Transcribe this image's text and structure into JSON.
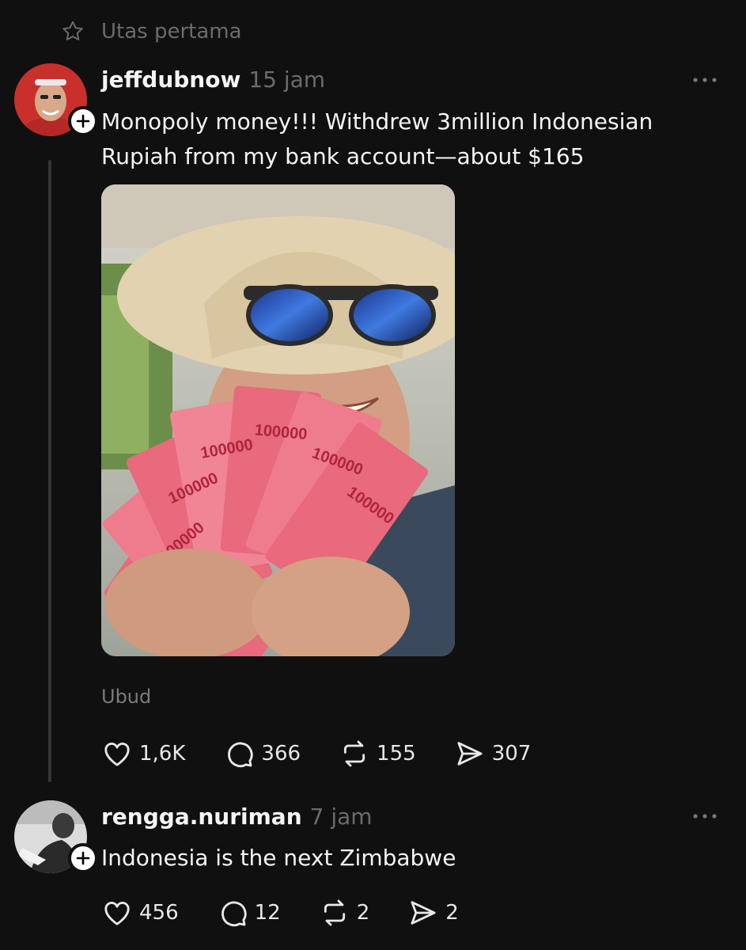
{
  "pinned": {
    "icon": "star-icon",
    "label": "Utas pertama"
  },
  "post": {
    "username": "jeffdubnow",
    "time": "15 jam",
    "text": "Monopoly money!!! Withdrew 3million Indonesian Rupiah from my bank account—about $165",
    "location": "Ubud",
    "image_banknote_values": [
      "100000",
      "100000",
      "100000",
      "100000",
      "100000",
      "100000",
      "100000"
    ],
    "stats": {
      "likes": "1,6K",
      "replies": "366",
      "reposts": "155",
      "shares": "307"
    }
  },
  "reply": {
    "username": "rengga.nuriman",
    "time": "7 jam",
    "text": "Indonesia is the next Zimbabwe",
    "stats": {
      "likes": "456",
      "replies": "12",
      "reposts": "2",
      "shares": "2"
    }
  },
  "colors": {
    "background": "#101010",
    "text": "#f3f5f7",
    "muted": "#6b6b6b",
    "banknote": "#e86a7c"
  }
}
